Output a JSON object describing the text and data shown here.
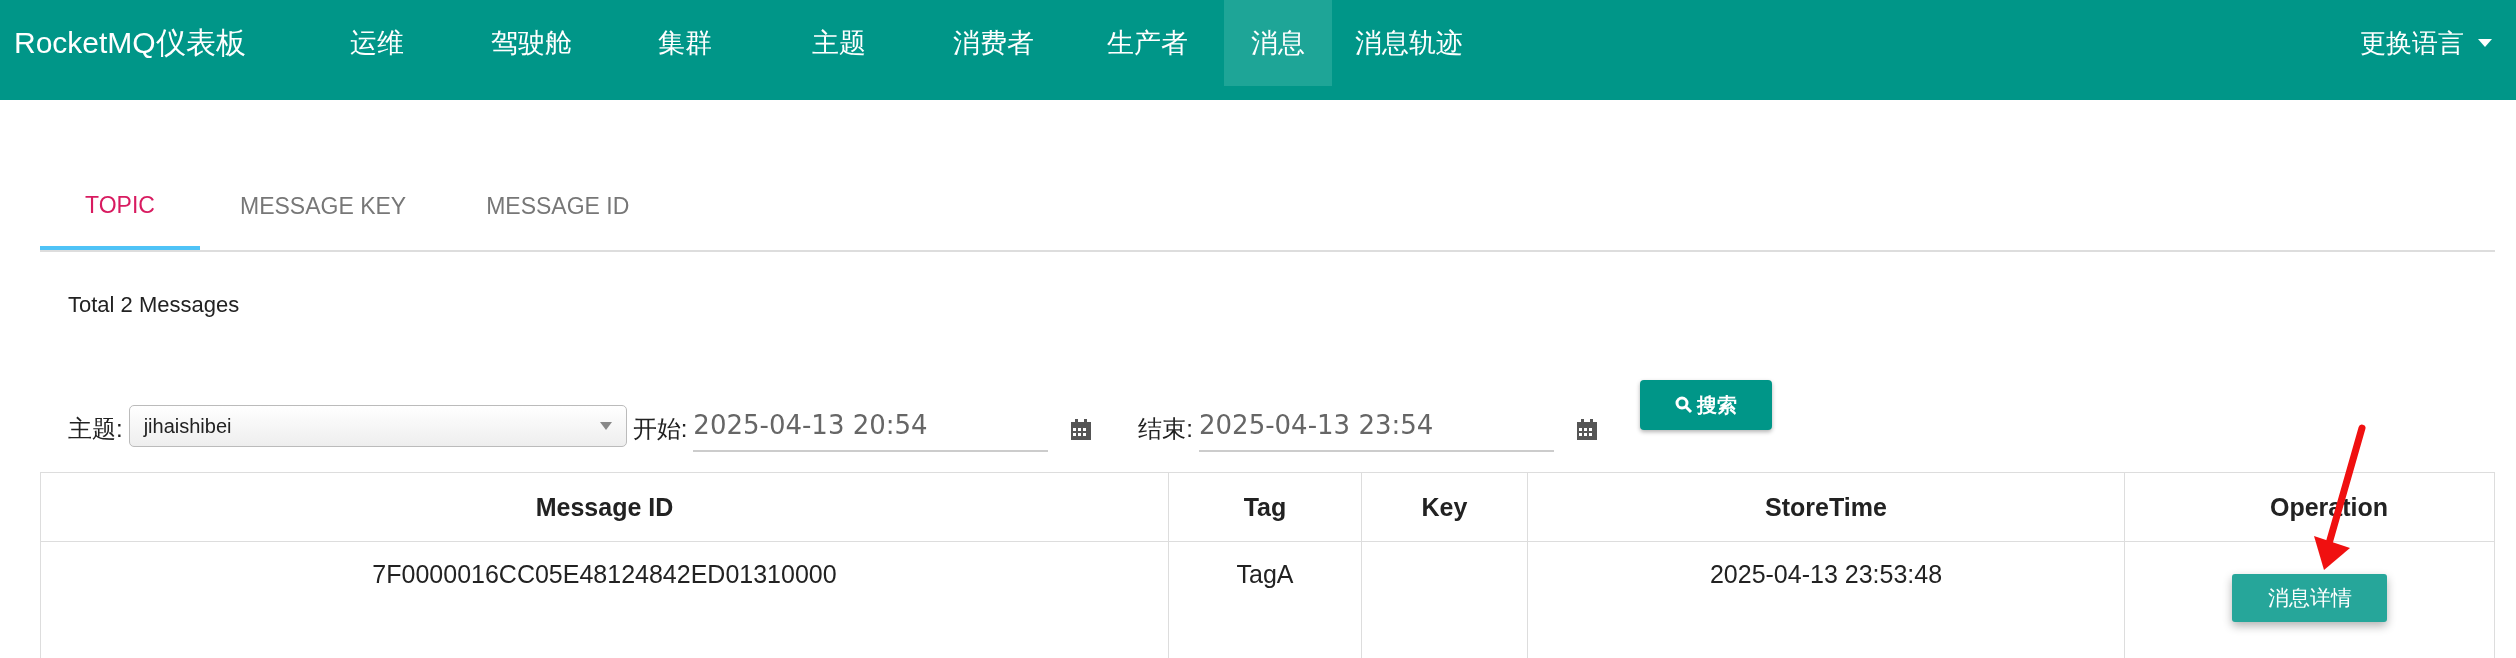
{
  "navbar": {
    "brand": "RocketMQ仪表板",
    "items": [
      {
        "label": "运维",
        "selected": false
      },
      {
        "label": "驾驶舱",
        "selected": false
      },
      {
        "label": "集群",
        "selected": false
      },
      {
        "label": "主题",
        "selected": false
      },
      {
        "label": "消费者",
        "selected": false
      },
      {
        "label": "生产者",
        "selected": false
      },
      {
        "label": "消息",
        "selected": true
      },
      {
        "label": "消息轨迹",
        "selected": false
      }
    ],
    "language": "更换语言"
  },
  "tabs": [
    {
      "label": "TOPIC",
      "selected": true
    },
    {
      "label": "MESSAGE KEY",
      "selected": false
    },
    {
      "label": "MESSAGE ID",
      "selected": false
    }
  ],
  "total": "Total 2 Messages",
  "filter": {
    "topic_label": "主题:",
    "topic_value": "jihaishibei",
    "start_label": "开始:",
    "start_value": "2025-04-13 20:54",
    "end_label": "结束:",
    "end_value": "2025-04-13 23:54",
    "search_button": "搜索"
  },
  "table": {
    "columns": [
      "Message ID",
      "Tag",
      "Key",
      "StoreTime",
      "Operation"
    ],
    "rows": [
      {
        "message_id": "7F0000016CC05E48124842ED01310000",
        "tag": "TagA",
        "store_time": "2025-04-13 23:53:48",
        "operation": "消息详情"
      }
    ]
  }
}
